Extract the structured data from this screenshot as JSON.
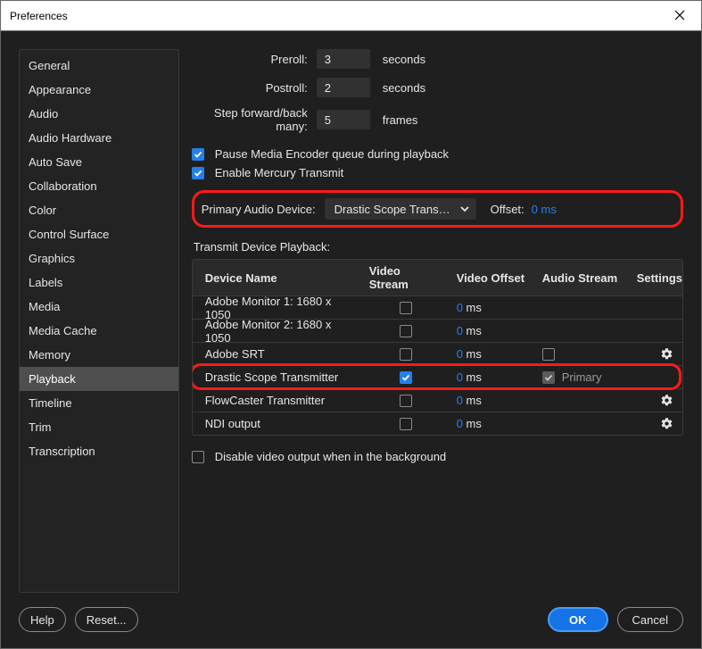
{
  "window": {
    "title": "Preferences"
  },
  "sidebar": {
    "items": [
      "General",
      "Appearance",
      "Audio",
      "Audio Hardware",
      "Auto Save",
      "Collaboration",
      "Color",
      "Control Surface",
      "Graphics",
      "Labels",
      "Media",
      "Media Cache",
      "Memory",
      "Playback",
      "Timeline",
      "Trim",
      "Transcription"
    ],
    "activeIndex": 13
  },
  "playback": {
    "prerollLabel": "Preroll:",
    "prerollValue": "3",
    "prerollUnit": "seconds",
    "postrollLabel": "Postroll:",
    "postrollValue": "2",
    "postrollUnit": "seconds",
    "stepLabel": "Step forward/back many:",
    "stepValue": "5",
    "stepUnit": "frames",
    "pauseMediaEncoder": "Pause Media Encoder queue during playback",
    "enableMercury": "Enable Mercury Transmit",
    "primaryAudioLabel": "Primary Audio Device:",
    "primaryAudioValue": "Drastic Scope Transmi...",
    "offsetLabel": "Offset:",
    "offsetValue": "0 ms",
    "tableLabel": "Transmit Device Playback:",
    "columns": {
      "name": "Device Name",
      "vs": "Video Stream",
      "vo": "Video Offset",
      "as": "Audio Stream",
      "set": "Settings"
    },
    "devices": [
      {
        "name": "Adobe Monitor 1: 1680 x 1050",
        "vs": false,
        "offset": "0 ms",
        "audio": null,
        "gear": false
      },
      {
        "name": "Adobe Monitor 2: 1680 x 1050",
        "vs": false,
        "offset": "0 ms",
        "audio": null,
        "gear": false
      },
      {
        "name": "Adobe SRT",
        "vs": false,
        "offset": "0 ms",
        "audio": "empty",
        "gear": true
      },
      {
        "name": "Drastic Scope Transmitter",
        "vs": true,
        "offset": "0 ms",
        "audio": "primary",
        "audioLabel": "Primary",
        "gear": false
      },
      {
        "name": "FlowCaster Transmitter",
        "vs": false,
        "offset": "0 ms",
        "audio": null,
        "gear": true
      },
      {
        "name": "NDI output",
        "vs": false,
        "offset": "0 ms",
        "audio": null,
        "gear": true
      }
    ],
    "disableBg": "Disable video output when in the background"
  },
  "footer": {
    "help": "Help",
    "reset": "Reset...",
    "ok": "OK",
    "cancel": "Cancel"
  }
}
